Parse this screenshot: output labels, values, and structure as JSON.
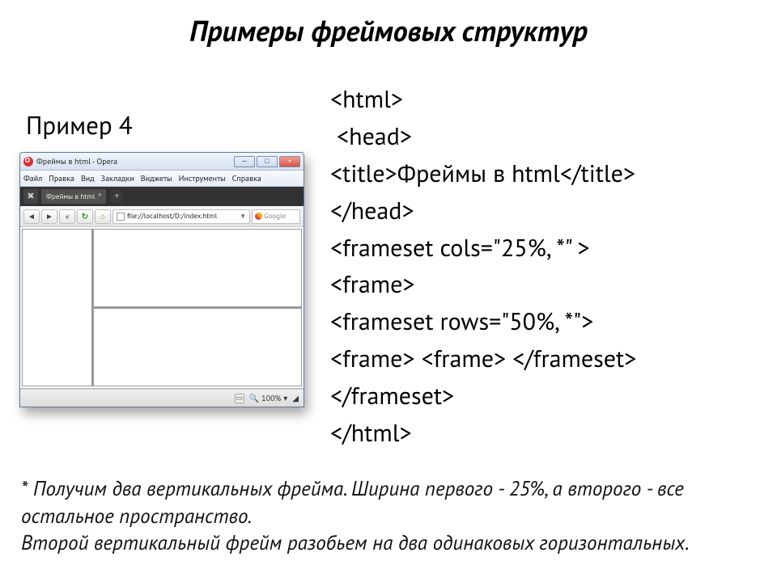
{
  "slide": {
    "title": "Примеры фреймовых структур",
    "example_label": "Пример 4"
  },
  "browser": {
    "window_title": "Фреймы в html - Opera",
    "min_label": "—",
    "max_label": "□",
    "close_label": "×",
    "menu": [
      "Файл",
      "Правка",
      "Вид",
      "Закладки",
      "Виджеты",
      "Инструменты",
      "Справка"
    ],
    "tab_label": "Фреймы в html",
    "tab_close": "×",
    "newtab": "+",
    "wrench_glyph": "✖",
    "nav": {
      "back": "◄",
      "fwd": "►",
      "rewind": "«",
      "reload": "↻",
      "home": "⌂",
      "url": "file://localhost/D:/index.html",
      "dropdown": "▼",
      "search_placeholder": "Google"
    },
    "status": {
      "zoom_icon": "🔍",
      "zoom": "100%",
      "dropdown": "▾",
      "resize": "◢"
    }
  },
  "code": {
    "lines": [
      "<html>",
      " <head>",
      "<title>Фреймы в html</title>",
      "</head>",
      "<frameset cols=\"25%, *\" >",
      "<frame>",
      "<frameset rows=\"50%, *\">",
      "<frame> <frame> </frameset>",
      "</frameset>",
      "</html>"
    ]
  },
  "footnote": {
    "line1": "* Получим два вертикальных фрейма. Ширина первого - 25%, а второго - все остальное пространство.",
    "line2": "Второй вертикальный фрейм разобьем на два одинаковых горизонтальных."
  }
}
